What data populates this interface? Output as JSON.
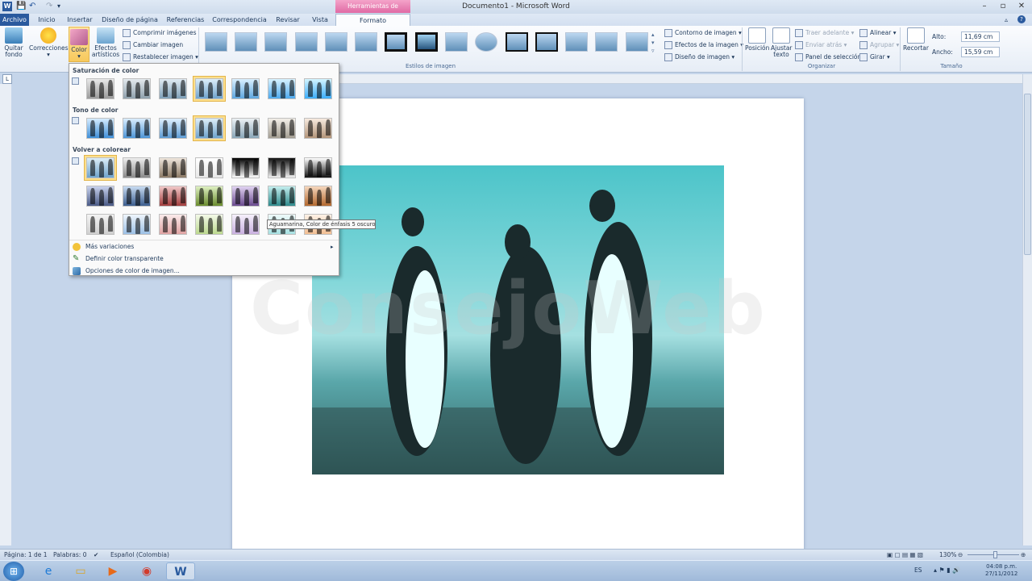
{
  "window": {
    "title": "Documento1 - Microsoft Word",
    "context_tab_header": "Herramientas de imagen"
  },
  "tabs": [
    {
      "label": "Archivo"
    },
    {
      "label": "Inicio"
    },
    {
      "label": "Insertar"
    },
    {
      "label": "Diseño de página"
    },
    {
      "label": "Referencias"
    },
    {
      "label": "Correspondencia"
    },
    {
      "label": "Revisar"
    },
    {
      "label": "Vista"
    },
    {
      "label": "Formato"
    }
  ],
  "ribbon": {
    "adjust": {
      "remove_bg": "Quitar fondo",
      "corrections": "Correcciones",
      "color": "Color",
      "artistic": "Efectos artísticos",
      "compress": "Comprimir imágenes",
      "change": "Cambiar imagen",
      "reset": "Restablecer imagen"
    },
    "styles": {
      "group_label": "Estilos de imagen",
      "border": "Contorno de imagen",
      "effects": "Efectos de la imagen",
      "layout": "Diseño de imagen"
    },
    "arrange": {
      "group_label": "Organizar",
      "position": "Posición",
      "wrap": "Ajustar texto",
      "bring_forward": "Traer adelante",
      "send_backward": "Enviar atrás",
      "selection_pane": "Panel de selección",
      "align": "Alinear",
      "group": "Agrupar",
      "rotate": "Girar"
    },
    "size": {
      "group_label": "Tamaño",
      "crop": "Recortar",
      "height_label": "Alto:",
      "height_value": "11,69 cm",
      "width_label": "Ancho:",
      "width_value": "15,59 cm"
    }
  },
  "dropdown": {
    "saturation_title": "Saturación de color",
    "tone_title": "Tono de color",
    "recolor_title": "Volver a colorear",
    "more_variations": "Más variaciones",
    "set_transparent": "Definir color transparente",
    "color_options": "Opciones de color de imagen...",
    "tooltip": "Aguamarina, Color de énfasis 5 oscuro"
  },
  "document": {
    "watermark": "ConsejoWeb"
  },
  "statusbar": {
    "page": "Página: 1 de 1",
    "words": "Palabras: 0",
    "language": "Español (Colombia)",
    "zoom": "130%"
  },
  "taskbar": {
    "lang": "ES",
    "time": "04:08 p.m.",
    "date": "27/11/2012"
  },
  "colors": {
    "accent": "#2a5a9e",
    "context": "#e06aa4",
    "selected": "#fcdf8c"
  }
}
